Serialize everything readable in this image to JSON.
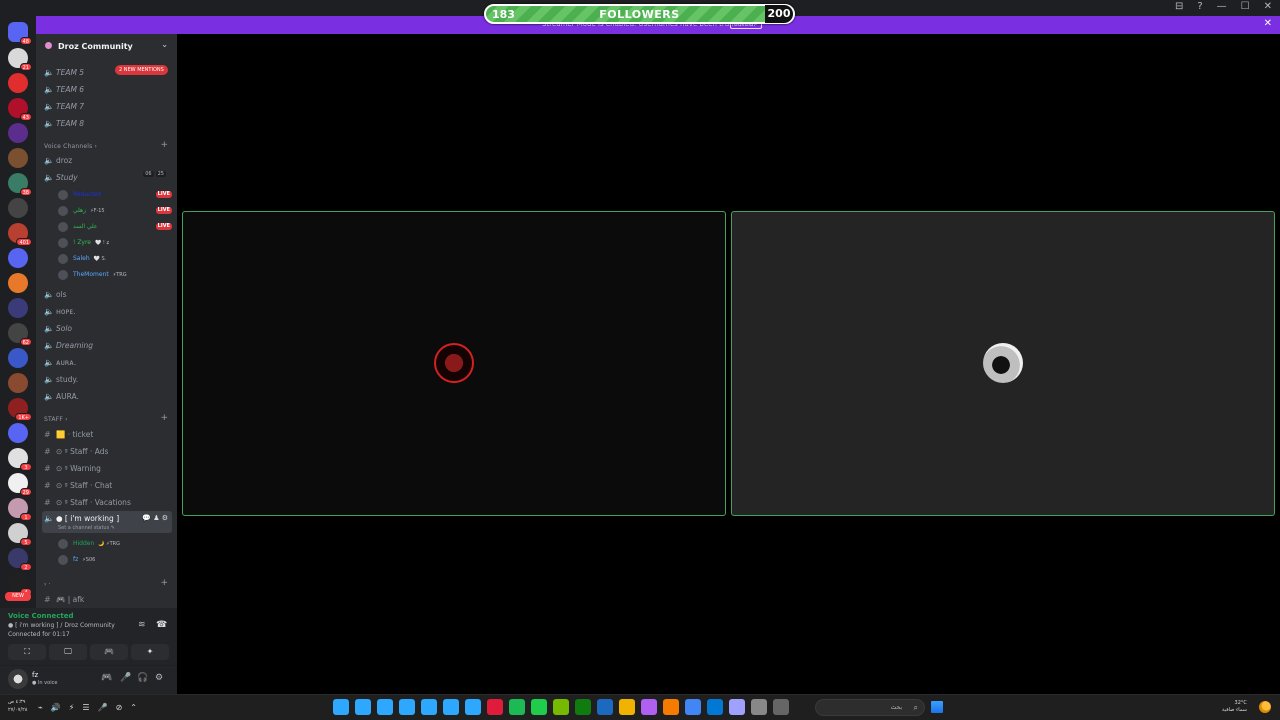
{
  "window": {
    "controls": [
      "⊟",
      "?",
      "—",
      "☐",
      "✕"
    ]
  },
  "followers": {
    "current": "183",
    "label": "FOLLOWERS",
    "goal": "200"
  },
  "banner": {
    "text": "Streamer Mode is enabled. Usernames have been truncated.",
    "disable_label": "Disable",
    "close": "✕"
  },
  "rail": {
    "home_badge": "48",
    "new_label": "NEW",
    "servers": [
      {
        "color": "#d9d9d9",
        "badge": "21"
      },
      {
        "color": "#e02e2e",
        "badge": ""
      },
      {
        "color": "#b0102a",
        "badge": "43"
      },
      {
        "color": "#5b2d8c",
        "badge": ""
      },
      {
        "color": "#7a5030",
        "badge": ""
      },
      {
        "color": "#3a7d66",
        "badge": "38"
      },
      {
        "color": "#444444",
        "badge": ""
      },
      {
        "color": "#b84030",
        "badge": "401"
      },
      {
        "color": "#5865f2",
        "badge": ""
      },
      {
        "color": "#e8792a",
        "badge": ""
      },
      {
        "color": "#3b3b7a",
        "badge": ""
      },
      {
        "color": "#444444",
        "badge": "62"
      },
      {
        "color": "#3a58c8",
        "badge": ""
      },
      {
        "color": "#8a4a30",
        "badge": ""
      },
      {
        "color": "#902020",
        "badge": "1K+"
      },
      {
        "color": "#5865f2",
        "badge": ""
      },
      {
        "color": "#e0e0e0",
        "badge": "3"
      },
      {
        "color": "#f0f0f0",
        "badge": "29"
      },
      {
        "color": "#c49ab0",
        "badge": "1"
      },
      {
        "color": "#d0d0d0",
        "badge": "5"
      },
      {
        "color": "#3a3a6a",
        "badge": "2"
      },
      {
        "color": "#202020",
        "badge": "4"
      }
    ]
  },
  "sidebar": {
    "server_name": "Droz Community",
    "chevron": "⌄",
    "mentions_badge": "2 NEW MENTIONS",
    "team_channels": [
      "TEAM 5",
      "TEAM 6",
      "TEAM 7",
      "TEAM 8"
    ],
    "voice_category": "Voice Channels ›",
    "voice_channels_top": [
      "droz",
      "Study"
    ],
    "study_counts": [
      "06",
      "25"
    ],
    "study_users": [
      {
        "name": "Redacted",
        "tag": "",
        "live": "LIVE",
        "color": "#1a33d6"
      },
      {
        "name": "زهلي",
        "tag": "⚡F-15",
        "live": "LIVE",
        "color": "#2fbf4f"
      },
      {
        "name": "علي السد",
        "tag": "",
        "live": "LIVE",
        "color": "#2fbf4f"
      },
      {
        "name": "! Zyre",
        "tag": "🤍 ! ʑ",
        "live": "",
        "color": "#2fbf4f"
      },
      {
        "name": "Saleh",
        "tag": "🤍 S.",
        "live": "",
        "color": "#5aa8ff"
      },
      {
        "name": "TheMoment",
        "tag": "⚡TRG",
        "live": "",
        "color": "#5aa8ff"
      }
    ],
    "voice_channels_bottom": [
      "ols",
      "ʜᴏᴘᴇ.",
      "Solo",
      "Dreaming",
      "ᴀᴜʀᴀ.",
      "study.",
      "AURA."
    ],
    "staff_category": "STAFF ›",
    "staff_channels": [
      "🟨 · ticket",
      "⊙ ᵍ Staff · Ads",
      "⊙ ᵍ Warning",
      "⊙ ᵍ Staff · Chat",
      "⊙ ᵍ Staff · Vacations"
    ],
    "active_channel": "● [ i'm working ]",
    "active_sub": "Set a channel status ✎",
    "active_users": [
      {
        "name": "Hidden",
        "tag": "🌙 ⚡TRG",
        "color": "#23a55a"
      },
      {
        "name": "fz",
        "tag": "⚡S06",
        "color": "#5aa8ff"
      }
    ],
    "misc_category": "› ·",
    "afk_channel": "🎮 | afk"
  },
  "voice_panel": {
    "title": "Voice Connected",
    "channel": "● [ i'm working ] / Droz Community",
    "time": "Connected for 01:17",
    "buttons": [
      "⛶",
      "🖵",
      "🎮",
      "✦"
    ]
  },
  "user_panel": {
    "name": "fz",
    "status": "● In voice",
    "buttons": [
      "🎮",
      "🎤",
      "🎧",
      "⚙"
    ]
  },
  "stage": {
    "tile_border": "#43a25a"
  },
  "taskbar": {
    "time": "٤:٣٩ ص",
    "date": "٢٧/٠٧/٢٨",
    "tray": [
      "⌁",
      "🔊",
      "⚡",
      "☰",
      "🎤",
      "⊘",
      "⌃"
    ],
    "search_placeholder": "بحث",
    "weather_temp": "32°C",
    "weather_desc": "سماء صافية",
    "apps": [
      "#2ea8ff",
      "#2ea8ff",
      "#2ea8ff",
      "#2ea8ff",
      "#2ea8ff",
      "#2ea8ff",
      "#2ea8ff",
      "#e01c3c",
      "#1db954",
      "#1fcc4b",
      "#76b900",
      "#107c10",
      "#1b6ac0",
      "#f0b400",
      "#b060f0",
      "#f57c00",
      "#4285f4",
      "#0078d4",
      "#a0a0ff",
      "#888888",
      "#666666"
    ]
  }
}
